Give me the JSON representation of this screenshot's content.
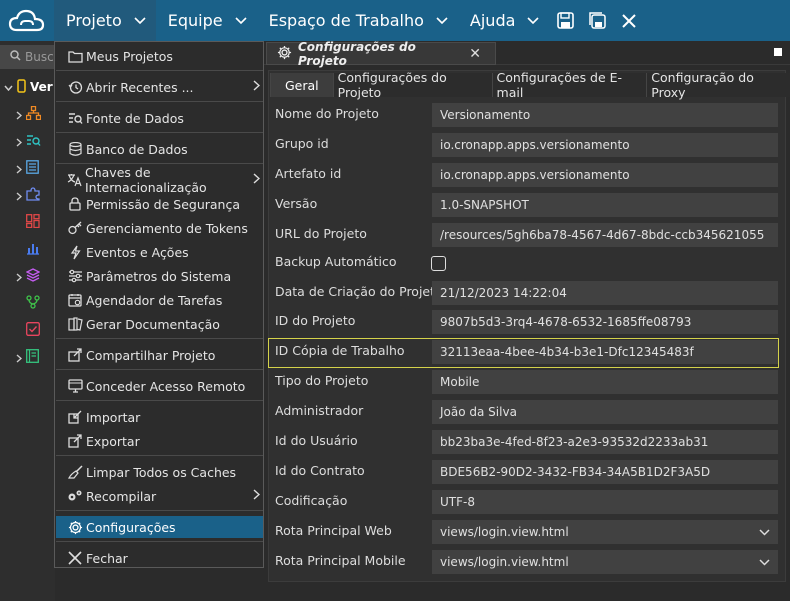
{
  "topbar": {
    "menus": [
      {
        "label": "Projeto"
      },
      {
        "label": "Equipe"
      },
      {
        "label": "Espaço de Trabalho"
      },
      {
        "label": "Ajuda"
      }
    ],
    "bg": "#1a6189"
  },
  "left": {
    "search_placeholder": "Busc",
    "root_label": "Ver"
  },
  "menu": {
    "items": [
      {
        "label": "Meus Projetos",
        "icon": "folder-icon"
      },
      {
        "label": "Abrir Recentes ...",
        "icon": "history-icon"
      },
      {
        "label": "Fonte de Dados",
        "icon": "datasource-icon"
      },
      {
        "label": "Banco de Dados",
        "icon": "database-icon"
      },
      {
        "label": "Chaves de Internacionalização",
        "icon": "translate-icon"
      },
      {
        "label": "Permissão de Segurança",
        "icon": "lock-icon"
      },
      {
        "label": "Gerenciamento de Tokens",
        "icon": "key-icon"
      },
      {
        "label": "Eventos e Ações",
        "icon": "bolt-icon"
      },
      {
        "label": "Parâmetros do Sistema",
        "icon": "sliders-icon"
      },
      {
        "label": "Agendador de Tarefas",
        "icon": "calendar-icon"
      },
      {
        "label": "Gerar Documentação",
        "icon": "docs-icon"
      },
      {
        "label": "Compartilhar Projeto",
        "icon": "share-icon"
      },
      {
        "label": "Conceder Acesso Remoto",
        "icon": "remote-icon"
      },
      {
        "label": "Importar",
        "icon": "import-icon"
      },
      {
        "label": "Exportar",
        "icon": "export-icon"
      },
      {
        "label": "Limpar Todos os Caches",
        "icon": "broom-icon"
      },
      {
        "label": "Recompilar",
        "icon": "gears-icon"
      },
      {
        "label": "Configurações",
        "icon": "gear-icon"
      },
      {
        "label": "Fechar",
        "icon": "close-icon"
      }
    ]
  },
  "doc_tab": {
    "title": "Configurações do Projeto",
    "close": "✕"
  },
  "subtabs": [
    "Geral",
    "Configurações do Projeto",
    "Configurações de E-mail",
    "Configuração do Proxy"
  ],
  "form": {
    "rows": [
      {
        "label": "Nome do Projeto",
        "value": "Versionamento"
      },
      {
        "label": "Grupo id",
        "value": "io.cronapp.apps.versionamento"
      },
      {
        "label": "Artefato id",
        "value": "io.cronapp.apps.versionamento"
      },
      {
        "label": "Versão",
        "value": "1.0-SNAPSHOT"
      },
      {
        "label": "URL do Projeto",
        "value": "/resources/5gh6ba78-4567-4d67-8bdc-ccb345621055"
      },
      {
        "label": "Backup Automático",
        "value": ""
      },
      {
        "label": "Data de Criação do Projeto",
        "value": "21/12/2023 14:22:04"
      },
      {
        "label": "ID do Projeto",
        "value": "9807b5d3-3rq4-4678-6532-1685ffe08793"
      },
      {
        "label": "ID Cópia de Trabalho",
        "value": "32113eaa-4bee-4b34-b3e1-Dfc12345483f"
      },
      {
        "label": "Tipo do Projeto",
        "value": "Mobile"
      },
      {
        "label": "Administrador",
        "value": "João da Silva"
      },
      {
        "label": "Id do Usuário",
        "value": "bb23ba3e-4fed-8f23-a2e3-93532d2233ab31"
      },
      {
        "label": "Id do Contrato",
        "value": "BDE56B2-90D2-3432-FB34-34A5B1D2F3A5D"
      },
      {
        "label": "Codificação",
        "value": "UTF-8"
      },
      {
        "label": "Rota Principal Web",
        "value": "views/login.view.html"
      },
      {
        "label": "Rota Principal Mobile",
        "value": "views/login.view.html"
      }
    ],
    "backup_checked": false
  }
}
